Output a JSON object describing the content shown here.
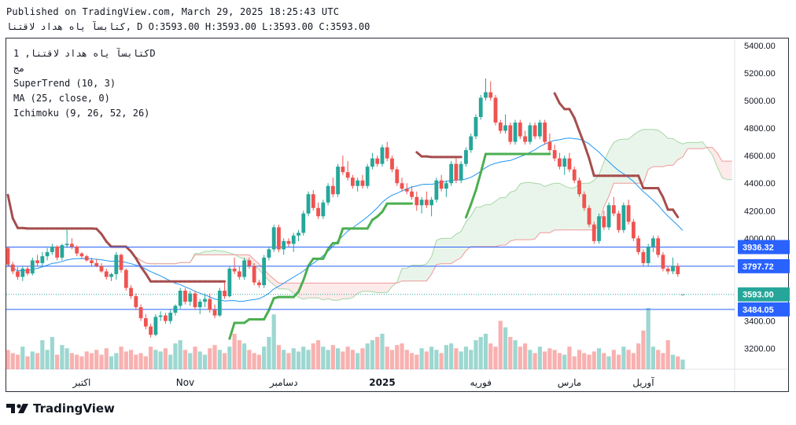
{
  "header": {
    "published": "Published on TradingView.com, March 29, 2025 18:25:43 UTC",
    "ohlc": "كتابسآ ياه هداد لاقتنا, D O:3593.00 H:3593.00 L:3593.00 C:3593.00"
  },
  "legend": {
    "symbol": "كتابسآ ياه هداد لاقتنا, 1D",
    "sub": "مج",
    "supertrend": "SuperTrend (10, 3)",
    "ma": "MA (25, close, 0)",
    "ichimoku": "Ichimoku (9, 26, 52, 26)"
  },
  "brand": {
    "name": "TradingView",
    "logo_icon": "tradingview-logo-icon"
  },
  "colors": {
    "up": "#26a69a",
    "down": "#ef5350",
    "supertrend_up": "#4caf50",
    "supertrend_down": "#a64d4d",
    "ma": "#2196f3",
    "hline": "#2962ff"
  },
  "chart_data": {
    "type": "candlestick",
    "ylim": [
      3050,
      5450
    ],
    "y_ticks": [
      "3200.00",
      "3400.00",
      "3600.00",
      "3800.00",
      "4000.00",
      "4200.00",
      "4400.00",
      "4600.00",
      "4800.00",
      "5000.00",
      "5200.00",
      "5400.00"
    ],
    "x_ticks": [
      {
        "label": "اکتبر",
        "bar": 15
      },
      {
        "label": "Nov",
        "bar": 36
      },
      {
        "label": "دسامبر",
        "bar": 56
      },
      {
        "label": "2025",
        "bar": 76
      },
      {
        "label": "فوریه",
        "bar": 96
      },
      {
        "label": "مارس",
        "bar": 114
      },
      {
        "label": "آوریل",
        "bar": 129
      }
    ],
    "price_labels": [
      {
        "value": 3936.32,
        "text": "3936.32"
      },
      {
        "value": 3797.72,
        "text": "3797.72"
      },
      {
        "value": 3593.0,
        "text": "3593.00"
      },
      {
        "value": 3484.05,
        "text": "3484.05"
      }
    ],
    "candles": [
      [
        3930,
        3940,
        3790,
        3810
      ],
      [
        3810,
        3830,
        3740,
        3760
      ],
      [
        3760,
        3790,
        3700,
        3720
      ],
      [
        3720,
        3800,
        3690,
        3780
      ],
      [
        3780,
        3800,
        3730,
        3745
      ],
      [
        3745,
        3860,
        3730,
        3840
      ],
      [
        3840,
        3880,
        3800,
        3820
      ],
      [
        3820,
        3900,
        3790,
        3870
      ],
      [
        3870,
        3930,
        3840,
        3900
      ],
      [
        3900,
        3960,
        3880,
        3940
      ],
      [
        3940,
        3950,
        3840,
        3860
      ],
      [
        3860,
        3960,
        3840,
        3950
      ],
      [
        3950,
        4070,
        3930,
        3960
      ],
      [
        3960,
        4000,
        3920,
        3940
      ],
      [
        3940,
        3950,
        3870,
        3890
      ],
      [
        3890,
        3900,
        3850,
        3870
      ],
      [
        3870,
        3880,
        3830,
        3840
      ],
      [
        3840,
        3860,
        3800,
        3820
      ],
      [
        3820,
        3850,
        3790,
        3800
      ],
      [
        3800,
        3820,
        3750,
        3760
      ],
      [
        3760,
        3780,
        3700,
        3720
      ],
      [
        3720,
        3750,
        3690,
        3740
      ],
      [
        3740,
        3900,
        3700,
        3880
      ],
      [
        3880,
        3890,
        3750,
        3770
      ],
      [
        3770,
        3780,
        3620,
        3640
      ],
      [
        3640,
        3660,
        3560,
        3580
      ],
      [
        3580,
        3600,
        3480,
        3500
      ],
      [
        3500,
        3520,
        3400,
        3420
      ],
      [
        3420,
        3450,
        3340,
        3360
      ],
      [
        3360,
        3380,
        3280,
        3300
      ],
      [
        3300,
        3450,
        3290,
        3430
      ],
      [
        3430,
        3470,
        3400,
        3440
      ],
      [
        3440,
        3460,
        3380,
        3400
      ],
      [
        3400,
        3480,
        3380,
        3460
      ],
      [
        3460,
        3520,
        3440,
        3510
      ],
      [
        3510,
        3640,
        3490,
        3620
      ],
      [
        3620,
        3640,
        3520,
        3540
      ],
      [
        3540,
        3620,
        3510,
        3600
      ],
      [
        3600,
        3620,
        3480,
        3500
      ],
      [
        3500,
        3560,
        3450,
        3540
      ],
      [
        3540,
        3600,
        3500,
        3560
      ],
      [
        3560,
        3600,
        3460,
        3480
      ],
      [
        3480,
        3520,
        3420,
        3440
      ],
      [
        3440,
        3640,
        3430,
        3620
      ],
      [
        3620,
        3680,
        3560,
        3580
      ],
      [
        3580,
        3800,
        3570,
        3780
      ],
      [
        3780,
        3860,
        3740,
        3760
      ],
      [
        3760,
        3800,
        3700,
        3720
      ],
      [
        3720,
        3860,
        3700,
        3840
      ],
      [
        3840,
        3860,
        3780,
        3800
      ],
      [
        3800,
        3820,
        3660,
        3680
      ],
      [
        3680,
        3700,
        3640,
        3660
      ],
      [
        3660,
        3880,
        3640,
        3860
      ],
      [
        3860,
        3940,
        3840,
        3920
      ],
      [
        3920,
        4100,
        3900,
        4080
      ],
      [
        4080,
        4100,
        3900,
        3920
      ],
      [
        3920,
        4000,
        3880,
        3980
      ],
      [
        3980,
        4000,
        3940,
        3960
      ],
      [
        3960,
        4040,
        3900,
        4020
      ],
      [
        4020,
        4060,
        3980,
        4040
      ],
      [
        4040,
        4200,
        4020,
        4180
      ],
      [
        4180,
        4340,
        4160,
        4320
      ],
      [
        4320,
        4350,
        4200,
        4220
      ],
      [
        4220,
        4260,
        4140,
        4160
      ],
      [
        4160,
        4280,
        4140,
        4260
      ],
      [
        4260,
        4400,
        4240,
        4380
      ],
      [
        4380,
        4440,
        4300,
        4320
      ],
      [
        4320,
        4540,
        4300,
        4520
      ],
      [
        4520,
        4600,
        4460,
        4480
      ],
      [
        4480,
        4560,
        4420,
        4440
      ],
      [
        4440,
        4460,
        4360,
        4380
      ],
      [
        4380,
        4440,
        4340,
        4420
      ],
      [
        4420,
        4460,
        4360,
        4380
      ],
      [
        4380,
        4540,
        4360,
        4520
      ],
      [
        4520,
        4620,
        4500,
        4580
      ],
      [
        4580,
        4600,
        4520,
        4540
      ],
      [
        4540,
        4680,
        4520,
        4660
      ],
      [
        4660,
        4700,
        4560,
        4580
      ],
      [
        4580,
        4600,
        4480,
        4500
      ],
      [
        4500,
        4520,
        4380,
        4400
      ],
      [
        4400,
        4440,
        4340,
        4360
      ],
      [
        4360,
        4400,
        4320,
        4340
      ],
      [
        4340,
        4380,
        4280,
        4300
      ],
      [
        4300,
        4340,
        4200,
        4240
      ],
      [
        4240,
        4300,
        4180,
        4280
      ],
      [
        4280,
        4340,
        4220,
        4240
      ],
      [
        4240,
        4300,
        4160,
        4280
      ],
      [
        4280,
        4440,
        4260,
        4420
      ],
      [
        4420,
        4460,
        4340,
        4360
      ],
      [
        4360,
        4420,
        4300,
        4400
      ],
      [
        4400,
        4560,
        4380,
        4540
      ],
      [
        4540,
        4580,
        4400,
        4420
      ],
      [
        4420,
        4560,
        4400,
        4540
      ],
      [
        4540,
        4660,
        4520,
        4640
      ],
      [
        4640,
        4760,
        4620,
        4740
      ],
      [
        4740,
        4900,
        4720,
        4880
      ],
      [
        4880,
        5040,
        4860,
        5020
      ],
      [
        5020,
        5160,
        5000,
        5060
      ],
      [
        5060,
        5140,
        5000,
        5020
      ],
      [
        5020,
        5040,
        4820,
        4840
      ],
      [
        4840,
        4860,
        4760,
        4780
      ],
      [
        4780,
        4900,
        4760,
        4820
      ],
      [
        4820,
        4840,
        4680,
        4700
      ],
      [
        4700,
        4860,
        4680,
        4840
      ],
      [
        4840,
        4860,
        4720,
        4740
      ],
      [
        4740,
        4780,
        4680,
        4700
      ],
      [
        4700,
        4840,
        4680,
        4820
      ],
      [
        4820,
        4840,
        4720,
        4740
      ],
      [
        4740,
        4860,
        4720,
        4840
      ],
      [
        4840,
        4860,
        4680,
        4700
      ],
      [
        4700,
        4760,
        4620,
        4640
      ],
      [
        4640,
        4680,
        4560,
        4580
      ],
      [
        4580,
        4620,
        4500,
        4520
      ],
      [
        4520,
        4600,
        4460,
        4580
      ],
      [
        4580,
        4620,
        4480,
        4500
      ],
      [
        4500,
        4520,
        4400,
        4420
      ],
      [
        4420,
        4440,
        4300,
        4320
      ],
      [
        4320,
        4340,
        4200,
        4220
      ],
      [
        4220,
        4240,
        4080,
        4100
      ],
      [
        4100,
        4120,
        3960,
        3980
      ],
      [
        3980,
        4180,
        3960,
        4160
      ],
      [
        4160,
        4200,
        4060,
        4080
      ],
      [
        4080,
        4260,
        4060,
        4240
      ],
      [
        4240,
        4300,
        4160,
        4180
      ],
      [
        4180,
        4200,
        4040,
        4060
      ],
      [
        4060,
        4260,
        4040,
        4240
      ],
      [
        4240,
        4280,
        4100,
        4120
      ],
      [
        4120,
        4140,
        3980,
        4000
      ],
      [
        4000,
        4020,
        3880,
        3900
      ],
      [
        3900,
        3920,
        3800,
        3820
      ],
      [
        3820,
        3960,
        3800,
        3940
      ],
      [
        3940,
        4020,
        3900,
        4000
      ],
      [
        4000,
        4020,
        3860,
        3880
      ],
      [
        3880,
        3900,
        3760,
        3780
      ],
      [
        3780,
        3800,
        3740,
        3760
      ],
      [
        3760,
        3860,
        3740,
        3800
      ],
      [
        3800,
        3820,
        3720,
        3740
      ],
      [
        3593,
        3593,
        3593,
        3593
      ]
    ],
    "volumes": [
      12,
      10,
      9,
      14,
      8,
      11,
      10,
      18,
      12,
      20,
      9,
      15,
      13,
      10,
      9,
      8,
      11,
      10,
      12,
      9,
      13,
      8,
      10,
      14,
      11,
      12,
      9,
      10,
      8,
      14,
      12,
      11,
      13,
      9,
      16,
      18,
      12,
      10,
      14,
      11,
      9,
      13,
      15,
      12,
      10,
      14,
      22,
      18,
      16,
      12,
      10,
      9,
      14,
      20,
      34,
      15,
      12,
      10,
      13,
      11,
      14,
      12,
      16,
      18,
      14,
      12,
      15,
      13,
      11,
      14,
      12,
      10,
      13,
      16,
      18,
      20,
      22,
      14,
      12,
      15,
      16,
      12,
      10,
      9,
      13,
      11,
      14,
      12,
      10,
      15,
      16,
      13,
      11,
      14,
      12,
      18,
      20,
      22,
      16,
      14,
      30,
      26,
      20,
      18,
      14,
      16,
      12,
      10,
      14,
      11,
      13,
      12,
      10,
      9,
      14,
      8,
      12,
      10,
      9,
      11,
      13,
      10,
      8,
      12,
      9,
      14,
      12,
      10,
      16,
      24,
      38,
      14,
      12,
      10,
      18,
      9,
      8,
      6,
      4,
      3
    ]
  }
}
